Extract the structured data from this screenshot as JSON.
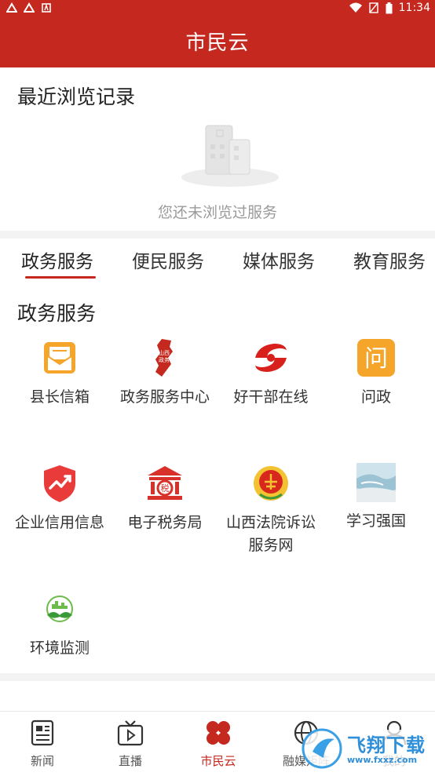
{
  "status_bar": {
    "time": "11:34"
  },
  "header": {
    "title": "市民云"
  },
  "recent": {
    "title": "最近浏览记录",
    "empty_text": "您还未浏览过服务"
  },
  "tabs": [
    {
      "label": "政务服务",
      "active": true
    },
    {
      "label": "便民服务",
      "active": false
    },
    {
      "label": "媒体服务",
      "active": false
    },
    {
      "label": "教育服务",
      "active": false
    }
  ],
  "section": {
    "title": "政务服务",
    "services": [
      {
        "label": "县长信箱",
        "icon": "mailbox-icon"
      },
      {
        "label": "政务服务中心",
        "icon": "shanxi-map-icon"
      },
      {
        "label": "好干部在线",
        "icon": "swirl-logo-icon"
      },
      {
        "label": "问政",
        "icon": "wen-icon",
        "icon_text": "问"
      },
      {
        "label": "企业信用信息",
        "icon": "shield-chart-icon"
      },
      {
        "label": "电子税务局",
        "icon": "tax-building-icon",
        "icon_text": "税"
      },
      {
        "label": "山西法院诉讼服务网",
        "icon": "court-emblem-icon"
      },
      {
        "label": "学习强国",
        "icon": "landscape-photo-icon"
      },
      {
        "label": "环境监测",
        "icon": "leaf-city-icon"
      }
    ]
  },
  "bottom_nav": [
    {
      "label": "新闻",
      "icon": "newspaper-icon",
      "active": false
    },
    {
      "label": "直播",
      "icon": "tv-play-icon",
      "active": false
    },
    {
      "label": "市民云",
      "icon": "clover-icon",
      "active": true
    },
    {
      "label": "融媒矩阵",
      "icon": "globe-icon",
      "active": false
    },
    {
      "label": "我的",
      "icon": "person-icon",
      "active": false
    }
  ],
  "watermark": {
    "text": "飞翔下载",
    "url_text": "www.fxxz.com"
  },
  "colors": {
    "brand_red": "#c4281e",
    "gray_text": "#9a9a9a",
    "divider": "#f3f3f3"
  }
}
